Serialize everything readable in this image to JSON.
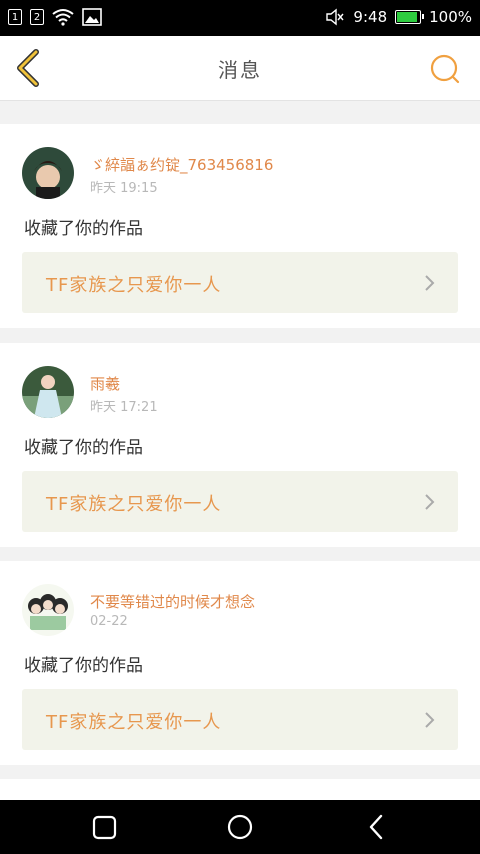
{
  "status_bar": {
    "sim1": "1",
    "sim2": "2",
    "time": "9:48",
    "battery": "100%"
  },
  "header": {
    "title": "消息",
    "back_icon": "chevron-left-icon",
    "search_icon": "search-icon",
    "accent_color": "#f0a040"
  },
  "messages": [
    {
      "user": "ゞ綷諨ぁ约锭_763456816",
      "time": "昨天 19:15",
      "action": "收藏了你的作品",
      "work_title": "TF家族之只爱你一人"
    },
    {
      "user": "雨羲",
      "time": "昨天 17:21",
      "action": "收藏了你的作品",
      "work_title": "TF家族之只爱你一人"
    },
    {
      "user": "不要等错过的时候才想念",
      "time": "02-22",
      "action": "收藏了你的作品",
      "work_title": "TF家族之只爱你一人"
    }
  ],
  "nav_bar": {
    "recents_icon": "square-icon",
    "home_icon": "circle-icon",
    "back_icon": "triangle-back-icon"
  }
}
